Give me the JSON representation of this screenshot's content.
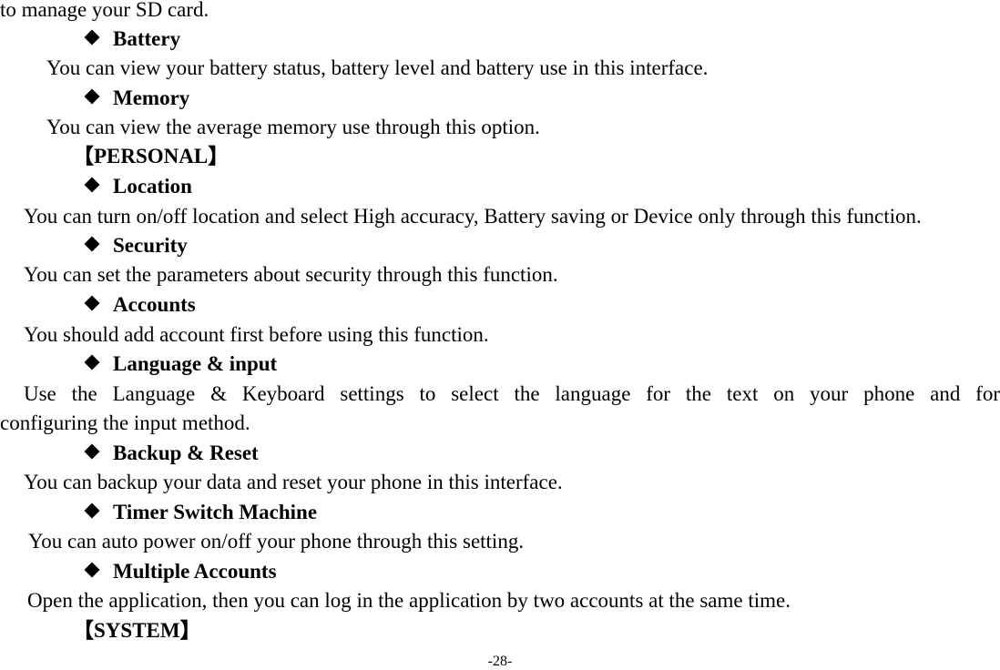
{
  "document": {
    "intro_continuation": "to manage your SD card.",
    "items": [
      {
        "title": "Battery",
        "desc": "You can view your battery status, battery level and battery use in this interface."
      },
      {
        "title": "Memory",
        "desc": "You can view the average memory use through this option."
      },
      {
        "section": "【PERSONAL】"
      },
      {
        "title": "Location",
        "desc": "You can turn on/off location and select High accuracy, Battery saving or Device only through this function."
      },
      {
        "title": "Security",
        "desc": "You can set the parameters about security through this function."
      },
      {
        "title": "Accounts",
        "desc": "You should add account first before using this function."
      },
      {
        "title": "Language & input",
        "desc_line1": "Use the Language & Keyboard settings to select the language for the text on your phone and for",
        "desc_line2": "configuring the input method."
      },
      {
        "title": "Backup & Reset",
        "desc": "You can backup your data and reset your phone in this interface."
      },
      {
        "title": "Timer Switch Machine",
        "desc": "You can auto power on/off your phone through this setting."
      },
      {
        "title": "Multiple Accounts",
        "desc": "Open the application, then you can log in the application by two accounts at the same time."
      },
      {
        "section": "【SYSTEM】"
      }
    ],
    "page_number": "-28-"
  },
  "icons": {
    "bullet": "diamond-bullet-icon"
  }
}
